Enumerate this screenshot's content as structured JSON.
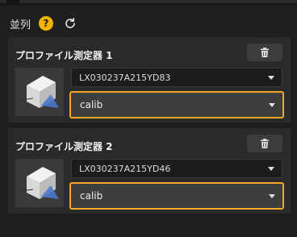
{
  "header": {
    "title": "並列",
    "help_glyph": "?"
  },
  "profilers": [
    {
      "name": "プロファイル測定器 1",
      "device": "LX030237A215YD83",
      "config": "calib"
    },
    {
      "name": "プロファイル測定器 2",
      "device": "LX030237A215YD46",
      "config": "calib"
    }
  ],
  "colors": {
    "accent": "#f5a623",
    "help": "#f0b400",
    "background": "#1f1f1f",
    "panel": "#2a2a2a"
  },
  "icons": {
    "help": "help-icon",
    "refresh": "refresh-icon",
    "delete": "trash-icon",
    "dropdown": "chevron-down-icon"
  }
}
